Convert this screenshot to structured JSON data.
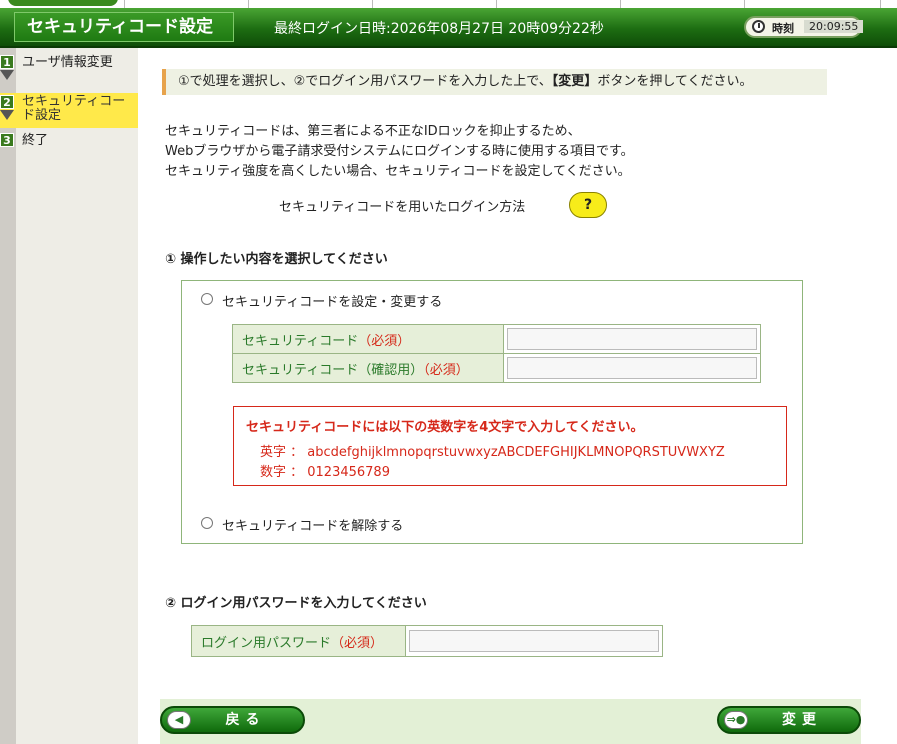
{
  "header": {
    "page_title": "セキュリティコード設定",
    "last_login": "最終ログイン日時:2026年08月27日 20時09分22秒",
    "clock_label": "時刻",
    "clock_time": "20:09:55"
  },
  "sidebar": {
    "items": [
      {
        "num": "1",
        "label": "ユーザ情報変更",
        "active": false
      },
      {
        "num": "2",
        "label": "セキュリティコード設定",
        "active": true
      },
      {
        "num": "3",
        "label": "終了",
        "active": false
      }
    ]
  },
  "instruction": {
    "text_before": "①で処理を選択し、②でログイン用パスワードを入力した上で、",
    "bold": "【変更】",
    "text_after": "ボタンを押してください。"
  },
  "description": {
    "line1": "セキュリティコードは、第三者による不正なIDロックを抑止するため、",
    "line2": "Webブラウザから電子請求受付システムにログインする時に使用する項目です。",
    "line3": "セキュリティ強度を高くしたい場合、セキュリティコードを設定してください。",
    "help_text": "セキュリティコードを用いたログイン方法",
    "help_button": "?"
  },
  "section1": {
    "heading": "① 操作したい内容を選択してください",
    "option_set": "セキュリティコードを設定・変更する",
    "code_label": "セキュリティコード",
    "code_confirm_label": "セキュリティコード（確認用）",
    "required": "（必須）",
    "rule_title": "セキュリティコードには以下の英数字を4文字で入力してください。",
    "rule_alpha": "英字 ： abcdefghijklmnopqrstuvwxyzABCDEFGHIJKLMNOPQRSTUVWXYZ",
    "rule_digits": "数字 ： 0123456789",
    "option_clear": "セキュリティコードを解除する"
  },
  "section2": {
    "heading": "② ログイン用パスワードを入力してください",
    "password_label": "ログイン用パスワード",
    "required": "（必須）"
  },
  "footer": {
    "back_label": "戻る",
    "change_label": "変更"
  },
  "colors": {
    "header_green": "#1d6d12",
    "sidebar_active": "#ffe94a",
    "required_red": "#d52a1a",
    "help_yellow": "#f7ec1a"
  }
}
